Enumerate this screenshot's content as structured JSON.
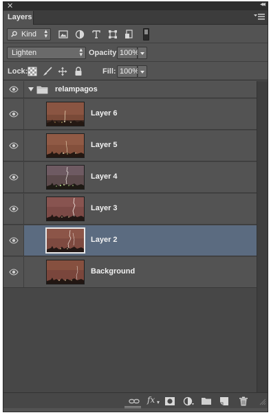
{
  "window": {
    "close_glyph": "✕",
    "collapse_glyph": "◂◂"
  },
  "tabs": [
    {
      "label": "Layers",
      "active": true
    }
  ],
  "filter": {
    "kind_label": "Kind",
    "icons": [
      "pixel-layer-filter-icon",
      "adjustment-layer-filter-icon",
      "type-layer-filter-icon",
      "shape-layer-filter-icon",
      "smart-object-filter-icon"
    ]
  },
  "blend": {
    "mode": "Lighten",
    "opacity_label": "Opacity:",
    "opacity_value": "100%"
  },
  "lock": {
    "label": "Lock:",
    "icons": [
      "lock-transparent-pixels-icon",
      "lock-image-pixels-icon",
      "lock-position-icon",
      "lock-all-icon"
    ],
    "fill_label": "Fill:",
    "fill_value": "100%"
  },
  "layers": [
    {
      "name": "relampagos",
      "type": "group",
      "visible": true,
      "expanded": true
    },
    {
      "name": "Layer 6",
      "type": "layer",
      "visible": true,
      "selected": false
    },
    {
      "name": "Layer 5",
      "type": "layer",
      "visible": true,
      "selected": false
    },
    {
      "name": "Layer 4",
      "type": "layer",
      "visible": true,
      "selected": false
    },
    {
      "name": "Layer 3",
      "type": "layer",
      "visible": true,
      "selected": false
    },
    {
      "name": "Layer 2",
      "type": "layer",
      "visible": true,
      "selected": true
    },
    {
      "name": "Background",
      "type": "layer",
      "visible": true,
      "selected": false
    }
  ],
  "bottom_bar": {
    "fx_label": "fx",
    "icons": [
      "link-layers-icon",
      "add-layer-style-icon",
      "add-layer-mask-icon",
      "new-adjustment-layer-icon",
      "new-group-icon",
      "new-layer-icon",
      "delete-layer-icon"
    ]
  },
  "colors": {
    "panel_bg": "#535353",
    "selected_row": "#5b6b80",
    "list_bg": "#474747"
  }
}
